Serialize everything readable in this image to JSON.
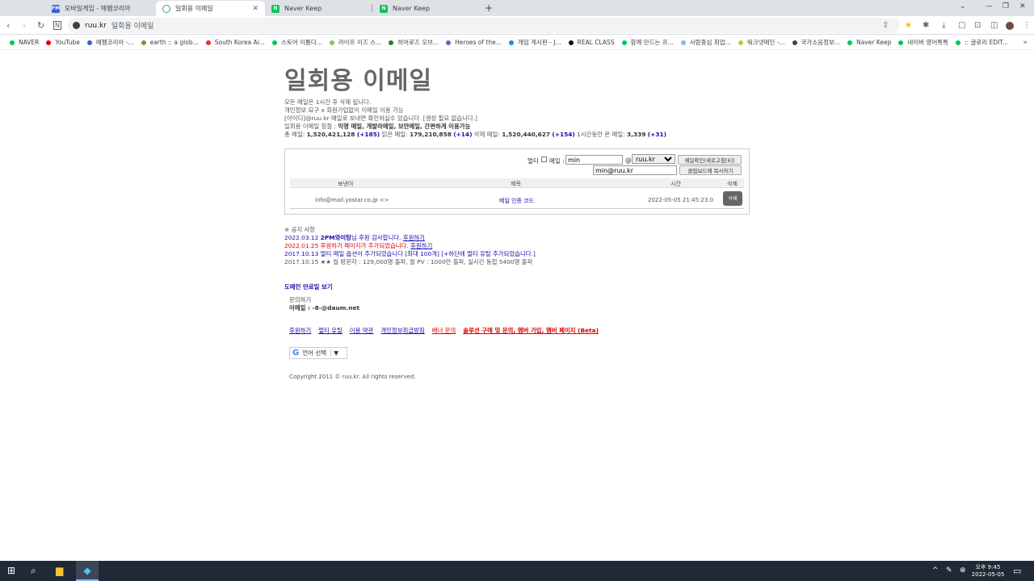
{
  "tabs": [
    {
      "label": "모바일게임 - 에펨코리아",
      "fav": "FM",
      "color": "#3b5fd0"
    },
    {
      "label": "일회용 이메일",
      "fav": "",
      "color": "#34a853"
    },
    {
      "label": "Naver Keep",
      "fav": "N",
      "color": "#03c75a"
    },
    {
      "label": "Naver Keep",
      "fav": "N",
      "color": "#03c75a"
    }
  ],
  "address": {
    "host": "ruu.kr",
    "title": "일회용 이메일"
  },
  "bookmarks": [
    {
      "label": "NAVER",
      "color": "#03c75a"
    },
    {
      "label": "YouTube",
      "color": "#e00"
    },
    {
      "label": "에펨코리아 -...",
      "color": "#3b5fd0"
    },
    {
      "label": "earth :: a glob...",
      "color": "#6a9e3a"
    },
    {
      "label": "South Korea Ai...",
      "color": "#d33"
    },
    {
      "label": "스토어 이름다...",
      "color": "#03c75a"
    },
    {
      "label": "라이프 이즈 스...",
      "color": "#8bc34a"
    },
    {
      "label": "히어로즈 오브...",
      "color": "#2e7d32"
    },
    {
      "label": "Heroes of the...",
      "color": "#5c6bc0"
    },
    {
      "label": "게임 게시판 - J...",
      "color": "#1e88e5"
    },
    {
      "label": "REAL CLASS",
      "color": "#111"
    },
    {
      "label": "함께 만드는 프...",
      "color": "#03c75a"
    },
    {
      "label": "사람중심 취업...",
      "color": "#8ab4f8"
    },
    {
      "label": "워크넷메인 -...",
      "color": "#c0ca33"
    },
    {
      "label": "국가소음정보...",
      "color": "#444"
    },
    {
      "label": "Naver Keep",
      "color": "#03c75a"
    },
    {
      "label": "네이버 영어톡톡",
      "color": "#03c75a"
    },
    {
      "label": ":: 글로리 EDIT...",
      "color": "#03c75a"
    }
  ],
  "page": {
    "title": "일회용 이메일",
    "intro1": "모든 메일은 1시간 후 삭제 됩니다.",
    "intro2": "개인정보 요구 x 회원가입없이 이메일 이용 가능",
    "intro3": "[아이디]@ruu.kr 메일로 보내면 확인하실수 있습니다. [생성 필요 없습니다.]",
    "intro4_pre": "일회용 이메일 장점 : ",
    "intro4_bold": "익명 메일, 개발라메일, 보안메일, 간편하게 이용가능",
    "stats": {
      "l1": "총 메일: ",
      "v1": "1,520,421,128",
      "d1": "(+185)",
      "l2": " 읽은 메일: ",
      "v2": "179,210,858",
      "d2": "(+14)",
      "l3": " 삭제 메일: ",
      "v3": "1,520,440,627",
      "d3": "(+154)",
      "l4": " 1시간동안 온 메일: ",
      "v4": "3,339",
      "d4": "(+31)"
    }
  },
  "form": {
    "multi_label": "멀티",
    "email_label": "메일 :",
    "id_value": "min",
    "at": "@",
    "domain_value": "ruu.kr",
    "check_button": "메일확인(새로고침[6])",
    "full_address": "min@ruu.kr",
    "copy_button": "클립보드에 복사하기"
  },
  "table": {
    "headers": [
      "보낸이",
      "제목",
      "시간",
      "삭제"
    ],
    "rows": [
      {
        "from": "info@mail.yostar.co.jp <>",
        "subject": "메일 인증 코드",
        "time": "2022-05-05 21:45:23.0",
        "delete": "삭제"
      }
    ]
  },
  "notice": {
    "heading": "※ 공지 사항",
    "n1_date": "2022.03.12 ",
    "n1_bold": "2PM와이탕",
    "n1_rest": "님 후원 감사합니다. ",
    "n1_link": "후원하기",
    "n2_text": "2022.01.25 후원하기 페이지가 추가되었습니다. ",
    "n2_link": "후원하기",
    "n3_text": "2017.10.13 멀티 메일 옵션이 추가되었습니다 [최대 100개] [+하단에 멀티 유틸 추가되었습니다.]",
    "n4_text": "2017.10.15 ★★ 월 방문자 : 129,000명 돌파, 월 PV : 1000만 돌파, 실시간 동접 5400명 돌파"
  },
  "domain_link": "도메인 만료일 보기",
  "contact": {
    "label": "문의하기",
    "email_label": "이메일 : ",
    "email": "-8-@daum.net"
  },
  "footer_links": [
    "후원하기",
    "멀티 유틸",
    "이용 약관",
    "개인정보취급방침",
    "배너 문의",
    "솔루션 구매 및 문의, 멤버 가입, 멤버 페이지 (Beta)"
  ],
  "lang": "언어 선택",
  "copyright": "Copyright 2011 © ruu.kr. All rights reserved.",
  "taskbar": {
    "time": "오후 9:45",
    "date": "2022-05-05"
  }
}
